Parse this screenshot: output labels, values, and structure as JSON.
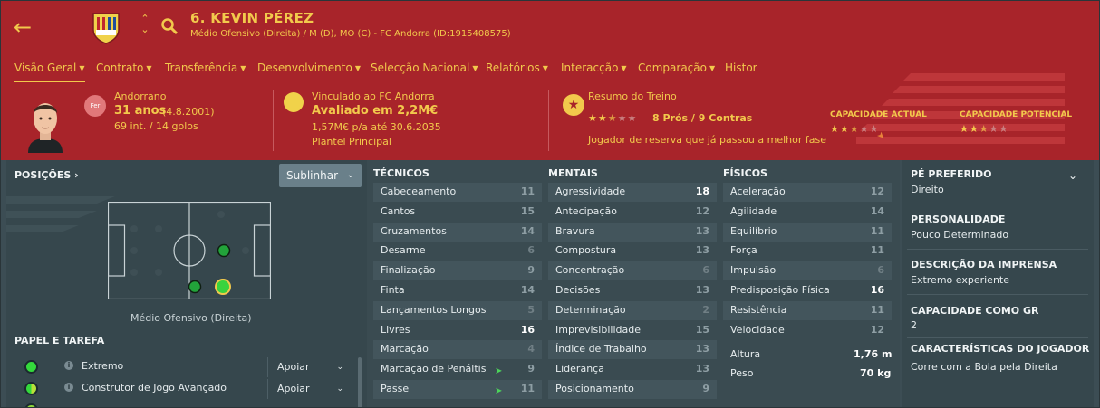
{
  "header": {
    "player_title": "6. KEVIN PÉREZ",
    "player_subtitle": "Médio Ofensivo (Direita) / M (D), MO (C) - FC Andorra (ID:1915408575)",
    "back_icon": "arrow-left-icon",
    "search_icon": "search-icon"
  },
  "tabs": [
    {
      "label": "Visão Geral",
      "dropdown": true
    },
    {
      "label": "Contrato",
      "dropdown": true
    },
    {
      "label": "Transferência",
      "dropdown": true
    },
    {
      "label": "Desenvolvimento",
      "dropdown": true
    },
    {
      "label": "Selecção Nacional",
      "dropdown": true
    },
    {
      "label": "Relatórios",
      "dropdown": true
    },
    {
      "label": "Interacção",
      "dropdown": true
    },
    {
      "label": "Comparação",
      "dropdown": true
    },
    {
      "label": "Histor",
      "dropdown": false
    }
  ],
  "summary": {
    "badge": "Fer",
    "nationality": "Andorrano",
    "age": "31 anos",
    "birthdate": "(4.8.2001)",
    "intl": "69 int. / 14 golos",
    "club_line": "Vinculado ao FC Andorra",
    "value": "Avaliado em 2,2M€",
    "wage": "1,57M€ p/a até 30.6.2035",
    "squad": "Plantel Principal",
    "training_title": "Resumo do Treino",
    "training_stars": 2.5,
    "training_counts": "8 Prós / 9 Contras",
    "training_note": "Jogador de reserva que já passou a melhor fase",
    "current_ability_label": "CAPACIDADE ACTUAL",
    "current_ability_stars": 2.5,
    "potential_ability_label": "CAPACIDADE POTENCIAL",
    "potential_ability_stars": 2.5
  },
  "positions": {
    "title": "POSIÇÕES",
    "highlight_button": "Sublinhar",
    "position_name": "Médio Ofensivo (Direita)",
    "role_title": "PAPEL E TAREFA",
    "roles": [
      {
        "name": "Extremo",
        "duty": "Apoiar"
      },
      {
        "name": "Construtor de Jogo Avançado",
        "duty": "Apoiar"
      }
    ]
  },
  "technical": {
    "title": "TÉCNICOS",
    "rows": [
      {
        "name": "Cabeceamento",
        "value": "11"
      },
      {
        "name": "Cantos",
        "value": "15"
      },
      {
        "name": "Cruzamentos",
        "value": "14"
      },
      {
        "name": "Desarme",
        "value": "6"
      },
      {
        "name": "Finalização",
        "value": "9"
      },
      {
        "name": "Finta",
        "value": "14"
      },
      {
        "name": "Lançamentos Longos",
        "value": "5"
      },
      {
        "name": "Livres",
        "value": "16"
      },
      {
        "name": "Marcação",
        "value": "4"
      },
      {
        "name": "Marcação de Penáltis",
        "value": "9"
      },
      {
        "name": "Passe",
        "value": "11"
      }
    ]
  },
  "mental": {
    "title": "MENTAIS",
    "rows": [
      {
        "name": "Agressividade",
        "value": "18"
      },
      {
        "name": "Antecipação",
        "value": "12"
      },
      {
        "name": "Bravura",
        "value": "13"
      },
      {
        "name": "Compostura",
        "value": "13"
      },
      {
        "name": "Concentração",
        "value": "6"
      },
      {
        "name": "Decisões",
        "value": "13"
      },
      {
        "name": "Determinação",
        "value": "2"
      },
      {
        "name": "Imprevisibilidade",
        "value": "15"
      },
      {
        "name": "Índice de Trabalho",
        "value": "13"
      },
      {
        "name": "Liderança",
        "value": "13"
      },
      {
        "name": "Posicionamento",
        "value": "9"
      }
    ]
  },
  "physical": {
    "title": "FÍSICOS",
    "rows": [
      {
        "name": "Aceleração",
        "value": "12"
      },
      {
        "name": "Agilidade",
        "value": "14"
      },
      {
        "name": "Equilíbrio",
        "value": "11"
      },
      {
        "name": "Força",
        "value": "11"
      },
      {
        "name": "Impulsão",
        "value": "6"
      },
      {
        "name": "Predisposição Física",
        "value": "16"
      },
      {
        "name": "Resistência",
        "value": "11"
      },
      {
        "name": "Velocidade",
        "value": "12"
      }
    ],
    "height_label": "Altura",
    "height_value": "1,76 m",
    "weight_label": "Peso",
    "weight_value": "70 kg"
  },
  "info": {
    "foot_title": "PÉ PREFERIDO",
    "foot_value": "Direito",
    "personality_title": "PERSONALIDADE",
    "personality_value": "Pouco Determinado",
    "media_title": "DESCRIÇÃO DA IMPRENSA",
    "media_value": "Extremo experiente",
    "gk_title": "CAPACIDADE COMO GR",
    "gk_value": "2",
    "traits_title": "CARACTERÍSTICAS DO JOGADOR",
    "traits_value": "Corre com a Bola pela Direita"
  },
  "colors": {
    "header_bg": "#a8242a",
    "accent": "#f2c94c",
    "panel_bg": "#3a4b51",
    "rating_green": "#34d93c"
  }
}
